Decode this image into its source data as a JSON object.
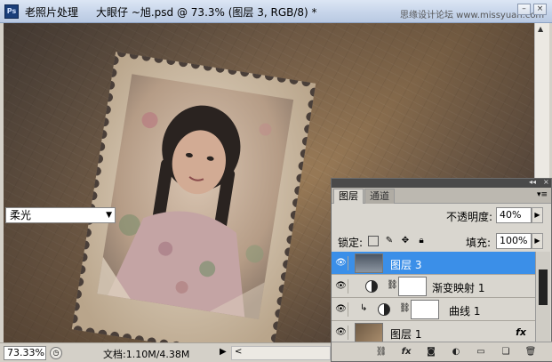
{
  "titlebar": {
    "app_badge": "Ps",
    "app_title": "老照片处理",
    "doc_title": "大眼仔 ~旭.psd @ 73.3% (图层 3, RGB/8) *",
    "watermark": "思缘设计论坛 www.missyuan.com",
    "minimize": "–",
    "close": "×"
  },
  "statusbar": {
    "zoom": "73.33%",
    "doc_info": "文档:1.10M/4.38M",
    "play": "▶",
    "scroll_left": "<"
  },
  "layers_panel": {
    "collapse": "◂◂",
    "close": "×",
    "tabs": [
      {
        "label": "图层",
        "active": true
      },
      {
        "label": "通道",
        "active": false
      }
    ],
    "menu_icon": "▾≡",
    "blend_mode": "柔光",
    "opacity_label": "不透明度:",
    "opacity_value": "40%",
    "lock_label": "锁定:",
    "fill_label": "填充:",
    "fill_value": "100%",
    "layers": [
      {
        "name": "图层 3",
        "selected": true,
        "type": "pixel"
      },
      {
        "name": "渐变映射 1",
        "selected": false,
        "type": "adjustment"
      },
      {
        "name": "曲线 1",
        "selected": false,
        "type": "adjustment-clipped"
      },
      {
        "name": "图层 1",
        "selected": false,
        "type": "pixel-fx",
        "fx": "fx"
      }
    ],
    "bottom_icons": [
      "link-icon",
      "fx-icon",
      "mask-icon",
      "adjustment-icon",
      "folder-icon",
      "new-layer-icon",
      "trash-icon"
    ]
  }
}
